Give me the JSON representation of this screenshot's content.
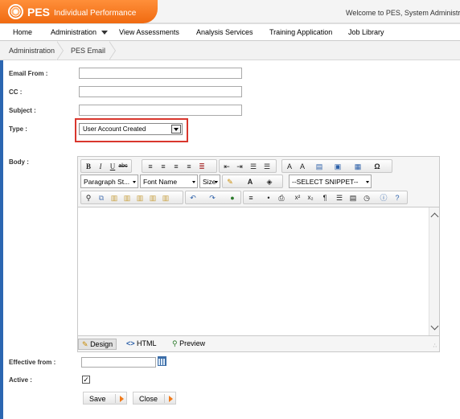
{
  "app": {
    "name": "PES",
    "subtitle": "Individual Performance",
    "welcome": "Welcome to PES, System Administrator"
  },
  "nav": {
    "items": [
      {
        "label": "Home"
      },
      {
        "label": "Administration"
      },
      {
        "label": "View Assessments"
      },
      {
        "label": "Analysis Services"
      },
      {
        "label": "Training Application"
      },
      {
        "label": "Job Library"
      }
    ]
  },
  "breadcrumb": {
    "items": [
      {
        "label": "Administration"
      },
      {
        "label": "PES Email"
      }
    ]
  },
  "form": {
    "email_from": {
      "label": "Email From :",
      "value": ""
    },
    "cc": {
      "label": "CC :",
      "value": ""
    },
    "subject": {
      "label": "Subject :",
      "value": ""
    },
    "type": {
      "label": "Type :",
      "selected": "User Account Created"
    },
    "body": {
      "label": "Body :"
    },
    "effective_from": {
      "label": "Effective from :",
      "value": ""
    },
    "active": {
      "label": "Active :",
      "checked": true,
      "mark": "✓"
    }
  },
  "editor": {
    "paragraph_style": "Paragraph St...",
    "font_name": "Font Name",
    "size": "Size",
    "snippet": "--SELECT SNIPPET--",
    "modes": [
      {
        "label": "Design",
        "icon": "pencil-icon"
      },
      {
        "label": "HTML",
        "icon": "code-icon"
      },
      {
        "label": "Preview",
        "icon": "magnifier-icon"
      }
    ]
  },
  "buttons": {
    "save": "Save",
    "close": "Close"
  },
  "colors": {
    "brand_orange": "#f06a10",
    "highlight_red": "#d9362d",
    "window_edge": "#2b66b1"
  }
}
